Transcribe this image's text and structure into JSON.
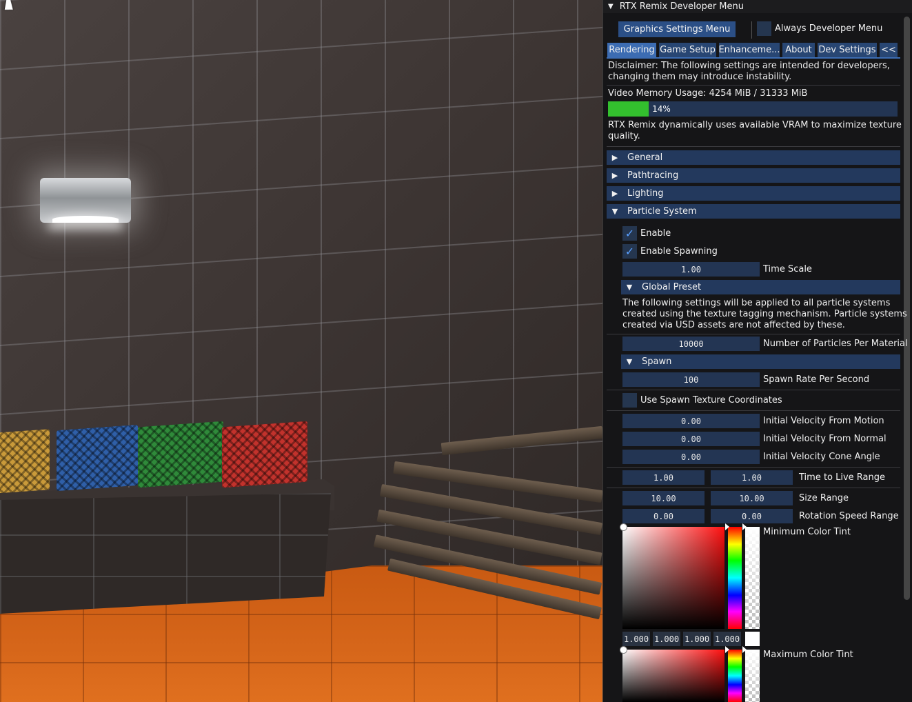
{
  "window": {
    "title": "RTX Remix Developer Menu"
  },
  "top_buttons": {
    "graphics": "Graphics Settings Menu",
    "always_dev": "Always Developer Menu"
  },
  "tabs": [
    {
      "label": "Rendering"
    },
    {
      "label": "Game Setup"
    },
    {
      "label": "Enhanceme..."
    },
    {
      "label": "About"
    },
    {
      "label": "Dev Settings"
    },
    {
      "label": "<<"
    }
  ],
  "disclaimer": {
    "line1": "Disclaimer: The following settings are intended for developers,",
    "line2": "changing them may introduce instability."
  },
  "vram": {
    "label_prefix": "Video Memory Usage: ",
    "used": "4254 MiB",
    "sep": " / ",
    "total": "31333 MiB",
    "percent_label": "14%",
    "percent_value": 14,
    "note1": "RTX Remix dynamically uses available VRAM to maximize texture",
    "note2": "quality.",
    "bar_color": "#33c02e"
  },
  "sections": {
    "general": "General",
    "pathtracing": "Pathtracing",
    "lighting": "Lighting",
    "particle_system": "Particle System"
  },
  "particles": {
    "enable": "Enable",
    "enable_checked": true,
    "enable_spawning": "Enable Spawning",
    "enable_spawning_checked": true,
    "time_scale_value": "1.00",
    "time_scale_label": "Time Scale",
    "global_preset": "Global Preset",
    "preset_note1": "The following settings will be applied to all particle systems",
    "preset_note2": "created using the texture tagging mechanism.  Particle systems",
    "preset_note3": "created via USD assets are not affected by these.",
    "num_particles_value": "10000",
    "num_particles_label": "Number of Particles Per Material",
    "spawn_header": "Spawn",
    "spawn_rate_value": "100",
    "spawn_rate_label": "Spawn Rate Per Second",
    "use_spawn_tex_label": "Use Spawn Texture Coordinates",
    "use_spawn_tex_checked": false,
    "vel_motion_value": "0.00",
    "vel_motion_label": "Initial Velocity From Motion",
    "vel_normal_value": "0.00",
    "vel_normal_label": "Initial Velocity From Normal",
    "vel_cone_value": "0.00",
    "vel_cone_label": "Initial Velocity Cone Angle",
    "ttl_min": "1.00",
    "ttl_max": "1.00",
    "ttl_label": "Time to Live Range",
    "size_min": "10.00",
    "size_max": "10.00",
    "size_label": "Size Range",
    "rot_min": "0.00",
    "rot_max": "0.00",
    "rot_label": "Rotation Speed Range",
    "min_tint_label": "Minimum Color Tint",
    "min_tint_r": "1.000",
    "min_tint_g": "1.000",
    "min_tint_b": "1.000",
    "min_tint_a": "1.000",
    "max_tint_label": "Maximum Color Tint"
  },
  "colors": {
    "header_bg": "#23395d",
    "button_bg": "#2b4f86",
    "tab_active": "#3c6cb2",
    "field_bg": "#233553",
    "check_mark": "#5aa0ff"
  }
}
